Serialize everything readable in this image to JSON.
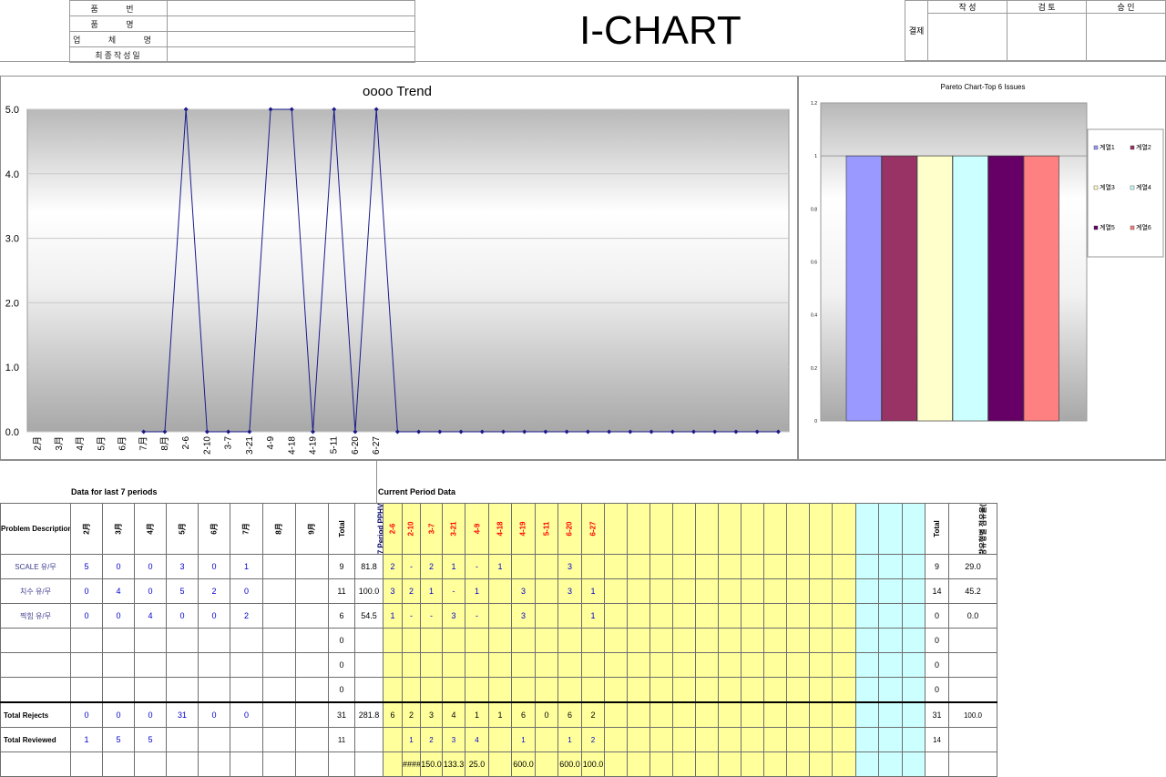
{
  "header": {
    "labels": [
      "품 번",
      "품 명",
      "업 체 명",
      "최종작성일"
    ],
    "title": "I-CHART",
    "approval_label": "결제",
    "approval_cols": [
      "작 성",
      "검 토",
      "승 인"
    ]
  },
  "trend": {
    "title": "oooo Trend",
    "y_ticks": [
      "0.0",
      "1.0",
      "2.0",
      "3.0",
      "4.0",
      "5.0"
    ],
    "ymax": 5,
    "categories": [
      "2月",
      "3月",
      "4月",
      "5月",
      "6月",
      "7月",
      "8月",
      "2-6",
      "2-10",
      "3-7",
      "3-21",
      "4-9",
      "4-18",
      "4-19",
      "5-11",
      "6-20",
      "6-27",
      "",
      "",
      "",
      "",
      "",
      "",
      "",
      "",
      "",
      "",
      "",
      "",
      "",
      "",
      "",
      "",
      "",
      "",
      ""
    ],
    "values": [
      0,
      0,
      0,
      0,
      0,
      0,
      0,
      5,
      0,
      0,
      0,
      5,
      5,
      0,
      5,
      0,
      5,
      0,
      0,
      0,
      0,
      0,
      0,
      0,
      0,
      0,
      0,
      0,
      0,
      0,
      0,
      0,
      0,
      0,
      0,
      0
    ],
    "line_color": "#1a1a8c"
  },
  "chart_data": [
    {
      "type": "line",
      "title": "oooo Trend",
      "categories": [
        "2月",
        "3月",
        "4月",
        "5月",
        "6月",
        "7月",
        "8月",
        "2-6",
        "2-10",
        "3-7",
        "3-21",
        "4-9",
        "4-18",
        "4-19",
        "5-11",
        "6-20",
        "6-27"
      ],
      "series": [
        {
          "values": [
            0,
            0,
            0,
            0,
            0,
            0,
            0,
            5,
            0,
            0,
            0,
            5,
            5,
            0,
            5,
            0,
            5
          ]
        }
      ],
      "ylim": [
        0,
        5
      ]
    },
    {
      "type": "bar",
      "title": "Pareto Chart-Top 6 Issues",
      "series": [
        {
          "name": "계열1",
          "values": [
            1
          ],
          "color": "#9999ff"
        },
        {
          "name": "계열2",
          "values": [
            1
          ],
          "color": "#993366"
        },
        {
          "name": "계열3",
          "values": [
            1
          ],
          "color": "#ffffcc"
        },
        {
          "name": "계열4",
          "values": [
            1
          ],
          "color": "#ccffff"
        },
        {
          "name": "계열5",
          "values": [
            1
          ],
          "color": "#660066"
        },
        {
          "name": "계열6",
          "values": [
            1
          ],
          "color": "#ff8080"
        }
      ],
      "y_ticks": [
        "0",
        "0.2",
        "0.4",
        "0.6",
        "0.8",
        "1",
        "1.2"
      ],
      "ylim": [
        0,
        1.2
      ]
    }
  ],
  "pareto": {
    "title": "Pareto Chart-Top 6 Issues",
    "y_ticks": [
      "0",
      "0.2",
      "0.4",
      "0.6",
      "0.8",
      "1",
      "1.2"
    ],
    "ymax": 1.2,
    "values": [
      1,
      1,
      1,
      1,
      1,
      1
    ],
    "colors": [
      "#9999ff",
      "#993366",
      "#ffffcc",
      "#ccffff",
      "#660066",
      "#ff8080"
    ],
    "legend": [
      "계열1",
      "계열2",
      "계열3",
      "계열4",
      "계열5",
      "계열6"
    ]
  },
  "table": {
    "section_left": "Data for last 7 periods",
    "section_right": "Current Period Data",
    "desc_header": "Problem Description",
    "months": [
      "2月",
      "3月",
      "4月",
      "5月",
      "6月",
      "7月",
      "8月",
      "9月"
    ],
    "total_label": "Total",
    "pphv_label": "7 Period PPHV",
    "periods": [
      "2-6",
      "2-10",
      "3-7",
      "3-21",
      "4-9",
      "4-18",
      "4-19",
      "5-11",
      "6-20",
      "6-27"
    ],
    "right_total_label": "Total",
    "rate_label": "불량유형별 점유율(%)",
    "rows": [
      {
        "desc": "SCALE 유/무",
        "m": [
          "5",
          "0",
          "0",
          "3",
          "0",
          "1",
          "",
          ""
        ],
        "total": "9",
        "pphv": "81.8",
        "p": [
          "2",
          "-",
          "2",
          "1",
          "-",
          "1",
          "",
          "",
          "3",
          ""
        ],
        "rt": "9",
        "rate": "29.0"
      },
      {
        "desc": "치수 유/무",
        "m": [
          "0",
          "4",
          "0",
          "5",
          "2",
          "0",
          "",
          ""
        ],
        "total": "11",
        "pphv": "100.0",
        "p": [
          "3",
          "2",
          "1",
          "-",
          "1",
          "",
          "3",
          "",
          "3",
          "1"
        ],
        "rt": "14",
        "rate": "45.2"
      },
      {
        "desc": "찍힘 유/무",
        "m": [
          "0",
          "0",
          "4",
          "0",
          "0",
          "2",
          "",
          ""
        ],
        "total": "6",
        "pphv": "54.5",
        "p": [
          "1",
          "-",
          "-",
          "3",
          "-",
          "",
          "3",
          "",
          "",
          "1"
        ],
        "rt": "0",
        "rate": "0.0"
      },
      {
        "desc": "",
        "m": [
          "",
          "",
          "",
          "",
          "",
          "",
          "",
          ""
        ],
        "total": "0",
        "pphv": "",
        "p": [
          "",
          "",
          "",
          "",
          "",
          "",
          "",
          "",
          "",
          ""
        ],
        "rt": "0",
        "rate": ""
      },
      {
        "desc": "",
        "m": [
          "",
          "",
          "",
          "",
          "",
          "",
          "",
          ""
        ],
        "total": "0",
        "pphv": "",
        "p": [
          "",
          "",
          "",
          "",
          "",
          "",
          "",
          "",
          "",
          ""
        ],
        "rt": "0",
        "rate": ""
      },
      {
        "desc": "",
        "m": [
          "",
          "",
          "",
          "",
          "",
          "",
          "",
          ""
        ],
        "total": "0",
        "pphv": "",
        "p": [
          "",
          "",
          "",
          "",
          "",
          "",
          "",
          "",
          "",
          ""
        ],
        "rt": "0",
        "rate": ""
      }
    ],
    "rejects": {
      "label": "Total Rejects",
      "m": [
        "0",
        "0",
        "0",
        "31",
        "0",
        "0",
        "",
        ""
      ],
      "total": "31",
      "pphv": "281.8",
      "p": [
        "6",
        "2",
        "3",
        "4",
        "1",
        "1",
        "6",
        "0",
        "6",
        "2"
      ],
      "rt": "31",
      "rate": "100.0"
    },
    "reviewed": {
      "label": "Total Reviewed",
      "m": [
        "1",
        "5",
        "5",
        "",
        "",
        "",
        "",
        ""
      ],
      "total": "11",
      "pphv": "",
      "p": [
        "",
        "1",
        "2",
        "3",
        "4",
        "",
        "1",
        "",
        "1",
        "2"
      ],
      "rt": "14",
      "rate": ""
    },
    "ratio": {
      "p": [
        "",
        "####",
        "150.0",
        "133.3",
        "25.0",
        "",
        "600.0",
        "",
        "600.0",
        "100.0"
      ]
    }
  }
}
